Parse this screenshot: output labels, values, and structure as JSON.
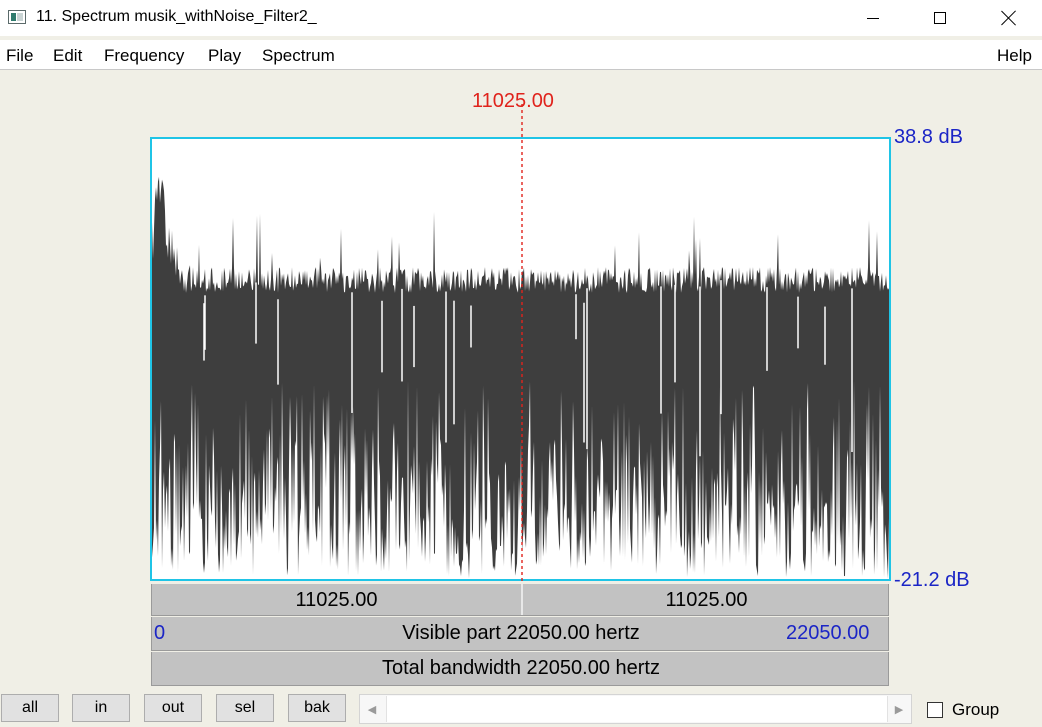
{
  "window": {
    "title": "11. Spectrum musik_withNoise_Filter2_"
  },
  "menu": {
    "file": "File",
    "edit": "Edit",
    "frequency": "Frequency",
    "play": "Play",
    "spectrum": "Spectrum",
    "help": "Help"
  },
  "spectrum": {
    "cursor_frequency": "11025.00",
    "db_max": "38.8 dB",
    "db_min": "-21.2 dB",
    "left_of_cursor": "11025.00",
    "right_of_cursor": "11025.00",
    "visible_start": "0",
    "visible_part": "Visible part 22050.00 hertz",
    "visible_end": "22050.00",
    "total_bandwidth": "Total bandwidth 22050.00 hertz",
    "colors": {
      "frame": "#1fc4e6",
      "cursor": "#e0231c",
      "db_labels": "#1b25c6",
      "fill": "#3e3e3e"
    }
  },
  "toolbar": {
    "all": "all",
    "in": "in",
    "out": "out",
    "sel": "sel",
    "bak": "bak",
    "group_label": "Group",
    "group_checked": false
  }
}
